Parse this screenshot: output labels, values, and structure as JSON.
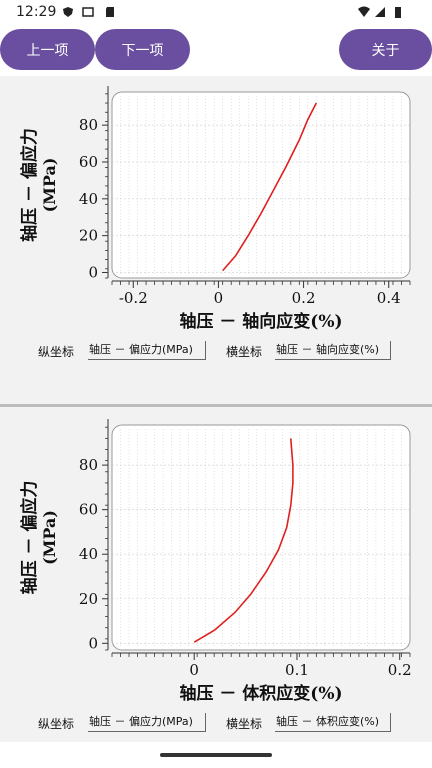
{
  "status_bar": {
    "time": "12:29"
  },
  "toolbar": {
    "prev_label": "上一项",
    "next_label": "下一项",
    "about_label": "关于"
  },
  "colors": {
    "accent": "#6a4fa0",
    "curve": "#e02020",
    "panel_bg": "#f2f2f2"
  },
  "chart_data": [
    {
      "type": "line",
      "xlabel": "轴压 － 轴向应变(%)",
      "ylabel": "轴压 － 偏应力\n(MPa)",
      "xlim": [
        -0.25,
        0.45
      ],
      "ylim": [
        -3,
        98
      ],
      "xticks": [
        "-0.2",
        "0",
        "0.2",
        "0.4"
      ],
      "yticks": [
        "0",
        "20",
        "40",
        "60",
        "80"
      ],
      "grid": true,
      "series": [
        {
          "x": [
            0.01,
            0.04,
            0.07,
            0.1,
            0.13,
            0.16,
            0.19,
            0.21,
            0.23
          ],
          "y": [
            1,
            9,
            20,
            32,
            45,
            58,
            72,
            83,
            92
          ]
        }
      ]
    },
    {
      "type": "line",
      "xlabel": "轴压 － 体积应变(%)",
      "ylabel": "轴压 － 偏应力\n(MPa)",
      "xlim": [
        -0.08,
        0.21
      ],
      "ylim": [
        -3,
        98
      ],
      "xticks": [
        "0",
        "0.1",
        "0.2"
      ],
      "yticks": [
        "0",
        "20",
        "40",
        "60",
        "80"
      ],
      "grid": true,
      "series": [
        {
          "x": [
            0.0,
            0.02,
            0.04,
            0.055,
            0.07,
            0.082,
            0.09,
            0.094,
            0.096,
            0.096,
            0.095,
            0.094
          ],
          "y": [
            0.5,
            6,
            14,
            22,
            32,
            42,
            52,
            62,
            72,
            80,
            86,
            92
          ]
        }
      ]
    }
  ],
  "chart1_selectors": {
    "y_label": "纵坐标",
    "y_value": "轴压 － 偏应力(MPa)",
    "x_label": "横坐标",
    "x_value": "轴压 － 轴向应变(%)"
  },
  "chart2_selectors": {
    "y_label": "纵坐标",
    "y_value": "轴压 － 偏应力(MPa)",
    "x_label": "横坐标",
    "x_value": "轴压 － 体积应变(%)"
  }
}
